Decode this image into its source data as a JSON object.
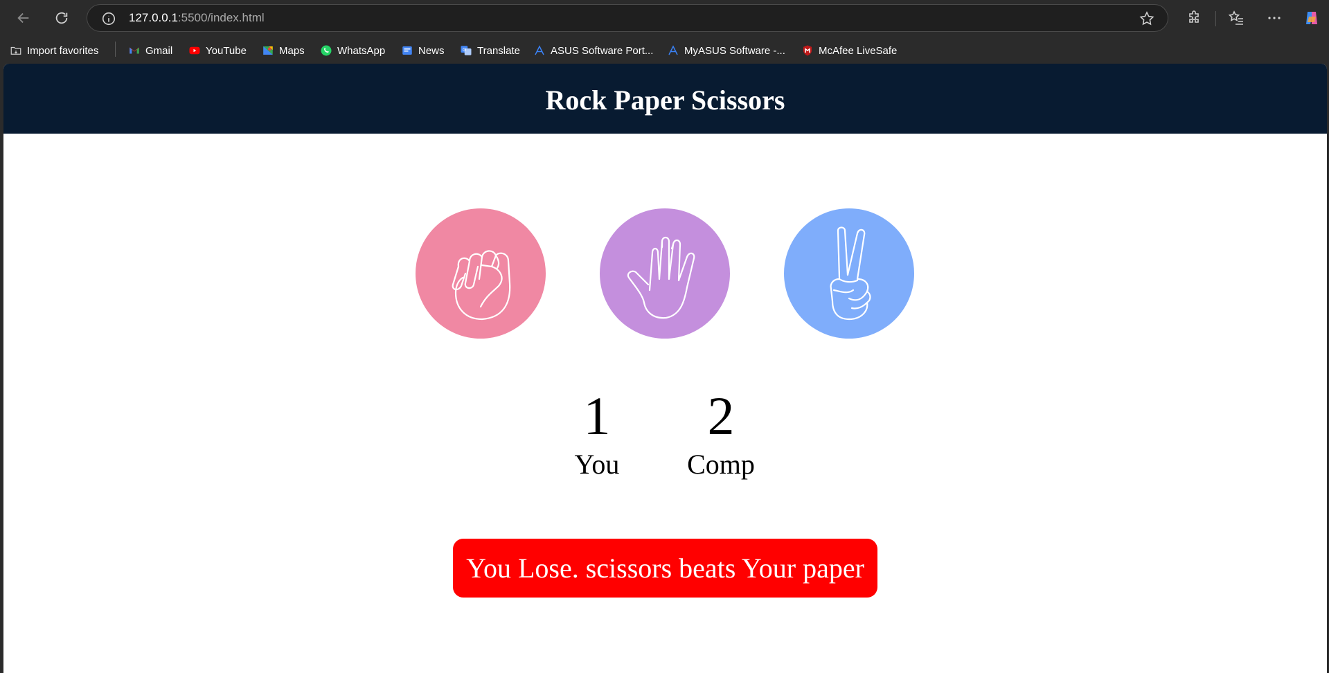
{
  "browser": {
    "url_host": "127.0.0.1",
    "url_rest": ":5500/index.html",
    "bookmarks": [
      {
        "label": "Import favorites",
        "icon": "import-favorites-icon"
      },
      {
        "label": "Gmail",
        "icon": "gmail-icon"
      },
      {
        "label": "YouTube",
        "icon": "youtube-icon"
      },
      {
        "label": "Maps",
        "icon": "maps-icon"
      },
      {
        "label": "WhatsApp",
        "icon": "whatsapp-icon"
      },
      {
        "label": "News",
        "icon": "news-icon"
      },
      {
        "label": "Translate",
        "icon": "translate-icon"
      },
      {
        "label": "ASUS Software Port...",
        "icon": "asus-icon"
      },
      {
        "label": "MyASUS Software -...",
        "icon": "asus-icon"
      },
      {
        "label": "McAfee LiveSafe",
        "icon": "mcafee-icon"
      }
    ]
  },
  "page": {
    "title": "Rock Paper Scissors",
    "choices": [
      {
        "name": "rock",
        "color": "#f088a3",
        "icon": "rock-fist-icon"
      },
      {
        "name": "paper",
        "color": "#c48fdd",
        "icon": "paper-hand-icon"
      },
      {
        "name": "scissors",
        "color": "#7fadfb",
        "icon": "scissors-hand-icon"
      }
    ],
    "score": {
      "user": "1",
      "user_label": "You",
      "comp": "2",
      "comp_label": "Comp"
    },
    "message": "You Lose. scissors beats Your paper",
    "message_color": "#ff0000",
    "header_color": "#081b31"
  }
}
